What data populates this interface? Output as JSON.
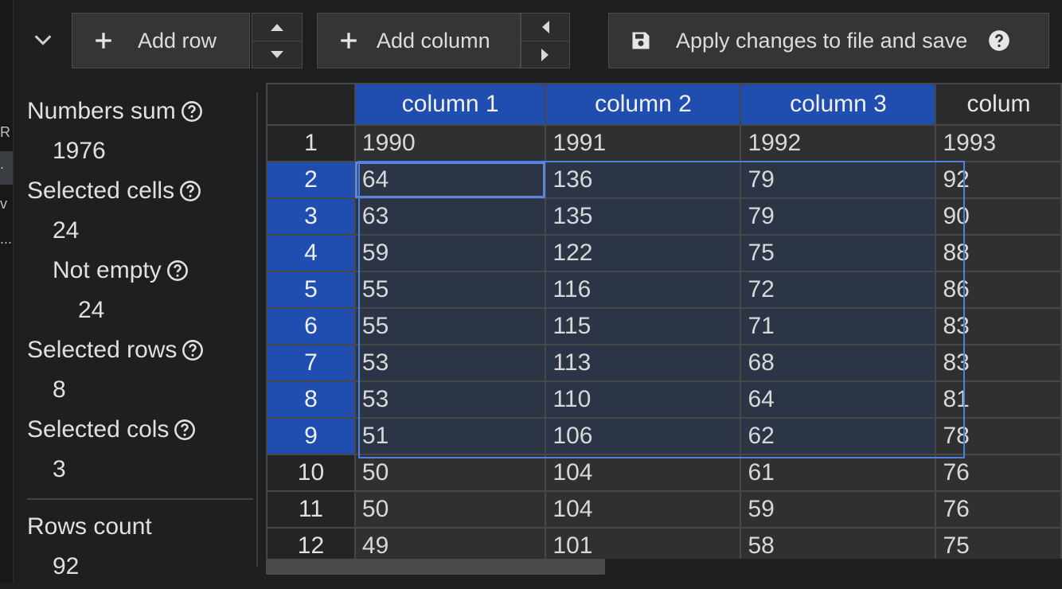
{
  "toolbar": {
    "add_row_label": "Add row",
    "add_column_label": "Add column",
    "apply_label": "Apply changes to file and save"
  },
  "left_strip": [
    "R",
    ".",
    "v",
    "..."
  ],
  "stats": {
    "numbers_sum_label": "Numbers sum",
    "numbers_sum": "1976",
    "selected_cells_label": "Selected cells",
    "selected_cells": "24",
    "not_empty_label": "Not empty",
    "not_empty": "24",
    "selected_rows_label": "Selected rows",
    "selected_rows": "8",
    "selected_cols_label": "Selected cols",
    "selected_cols": "3",
    "rows_count_label": "Rows count",
    "rows_count": "92"
  },
  "table": {
    "columns": [
      "column 1",
      "column 2",
      "column 3",
      "colum"
    ],
    "rows": [
      {
        "n": "1",
        "cells": [
          "1990",
          "1991",
          "1992",
          "1993"
        ]
      },
      {
        "n": "2",
        "cells": [
          "64",
          "136",
          "79",
          "92"
        ]
      },
      {
        "n": "3",
        "cells": [
          "63",
          "135",
          "79",
          "90"
        ]
      },
      {
        "n": "4",
        "cells": [
          "59",
          "122",
          "75",
          "88"
        ]
      },
      {
        "n": "5",
        "cells": [
          "55",
          "116",
          "72",
          "86"
        ]
      },
      {
        "n": "6",
        "cells": [
          "55",
          "115",
          "71",
          "83"
        ]
      },
      {
        "n": "7",
        "cells": [
          "53",
          "113",
          "68",
          "83"
        ]
      },
      {
        "n": "8",
        "cells": [
          "53",
          "110",
          "64",
          "81"
        ]
      },
      {
        "n": "9",
        "cells": [
          "51",
          "106",
          "62",
          "78"
        ]
      },
      {
        "n": "10",
        "cells": [
          "50",
          "104",
          "61",
          "76"
        ]
      },
      {
        "n": "11",
        "cells": [
          "50",
          "104",
          "59",
          "76"
        ]
      },
      {
        "n": "12",
        "cells": [
          "49",
          "101",
          "58",
          "75"
        ]
      }
    ],
    "selected_rows": [
      "2",
      "3",
      "4",
      "5",
      "6",
      "7",
      "8",
      "9"
    ],
    "selected_cols": [
      0,
      1,
      2
    ]
  },
  "colors": {
    "accent": "#1f4eb0",
    "selection_border": "#4f7fe0",
    "background": "#1e1f20"
  }
}
